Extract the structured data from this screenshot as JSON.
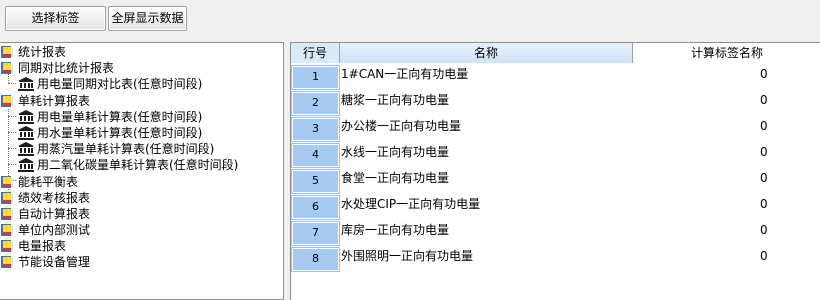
{
  "toolbar": {
    "select_label": "选择标签",
    "fullscreen_label": "全屏显示数据"
  },
  "tree": {
    "items": [
      {
        "label": "统计报表",
        "icon": "book-icon",
        "level": 0
      },
      {
        "label": "同期对比统计报表",
        "icon": "book-icon",
        "level": 0
      },
      {
        "label": "用电量同期对比表(任意时间段)",
        "icon": "bank-icon",
        "level": 1
      },
      {
        "label": "单耗计算报表",
        "icon": "book-icon",
        "level": 0
      },
      {
        "label": "用电量单耗计算表(任意时间段)",
        "icon": "bank-icon",
        "level": 1
      },
      {
        "label": "用水量单耗计算表(任意时间段)",
        "icon": "bank-icon",
        "level": 1
      },
      {
        "label": "用蒸汽量单耗计算表(任意时间段)",
        "icon": "bank-icon",
        "level": 1
      },
      {
        "label": "用二氧化碳量单耗计算表(任意时间段)",
        "icon": "bank-icon",
        "level": 1
      },
      {
        "label": "能耗平衡表",
        "icon": "book-icon",
        "level": 0
      },
      {
        "label": "绩效考核报表",
        "icon": "book-icon",
        "level": 0
      },
      {
        "label": "自动计算报表",
        "icon": "book-icon",
        "level": 0
      },
      {
        "label": "单位内部测试",
        "icon": "book-icon",
        "level": 0
      },
      {
        "label": "电量报表",
        "icon": "book-icon",
        "level": 0
      },
      {
        "label": "节能设备管理",
        "icon": "book-icon",
        "level": 0
      }
    ]
  },
  "grid": {
    "headers": {
      "no": "行号",
      "name": "名称",
      "tag": "计算标签名称"
    },
    "rows": [
      {
        "no": "1",
        "name": "1#CAN一正向有功电量",
        "tag": "0"
      },
      {
        "no": "2",
        "name": "糖浆一正向有功电量",
        "tag": "0"
      },
      {
        "no": "3",
        "name": "办公楼一正向有功电量",
        "tag": "0"
      },
      {
        "no": "4",
        "name": "水线一正向有功电量",
        "tag": "0"
      },
      {
        "no": "5",
        "name": "食堂一正向有功电量",
        "tag": "0"
      },
      {
        "no": "6",
        "name": "水处理CIP一正向有功电量",
        "tag": "0"
      },
      {
        "no": "7",
        "name": "库房一正向有功电量",
        "tag": "0"
      },
      {
        "no": "8",
        "name": "外围照明一正向有功电量",
        "tag": "0"
      }
    ]
  },
  "colors": {
    "row_header_fill": "#a6caf0",
    "header_fill": "#d9eafb"
  }
}
